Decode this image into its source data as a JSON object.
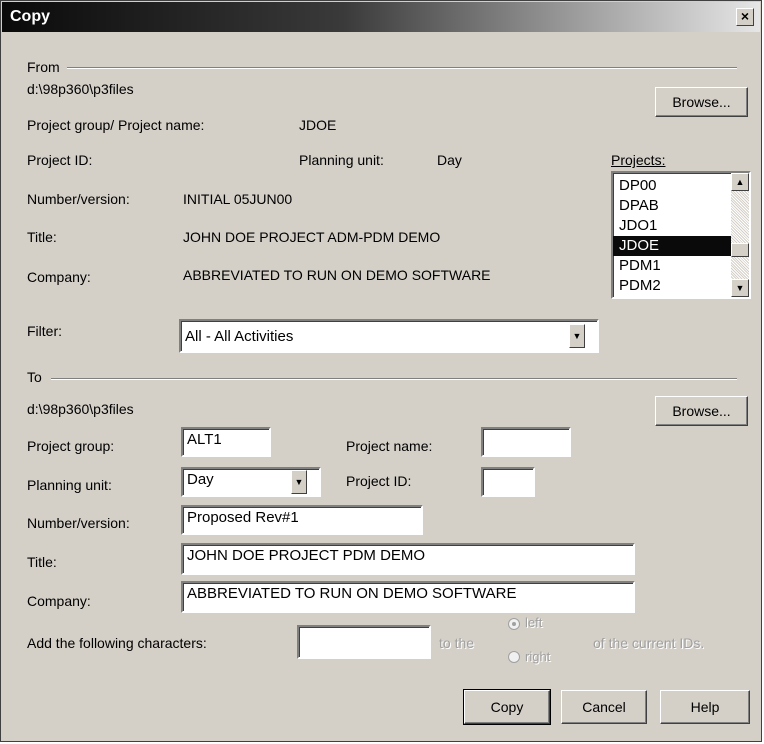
{
  "window": {
    "title": "Copy",
    "close_glyph": "×"
  },
  "from": {
    "header": "From",
    "path": "d:\\98p360\\p3files",
    "browse_label": "Browse...",
    "group_name_label": "Project group/ Project name:",
    "group_name_value": "JDOE",
    "project_id_label": "Project ID:",
    "planning_unit_label": "Planning unit:",
    "planning_unit_value": "Day",
    "number_version_label": "Number/version:",
    "number_version_value": "INITIAL 05JUN00",
    "title_label": "Title:",
    "title_value": "JOHN DOE PROJECT ADM-PDM DEMO",
    "company_label": "Company:",
    "company_value": "ABBREVIATED TO RUN ON DEMO SOFTWARE",
    "projects_label": "Projects:",
    "projects": [
      "DP00",
      "DPAB",
      "JDO1",
      "JDOE",
      "PDM1",
      "PDM2"
    ],
    "projects_selected": "JDOE"
  },
  "filter": {
    "label": "Filter:",
    "value": "All - All Activities"
  },
  "to": {
    "header": "To",
    "path": "d:\\98p360\\p3files",
    "browse_label": "Browse...",
    "project_group_label": "Project group:",
    "project_group_value": "ALT1",
    "project_name_label": "Project name:",
    "project_name_value": "",
    "planning_unit_label": "Planning unit:",
    "planning_unit_value": "Day",
    "project_id_label": "Project ID:",
    "project_id_value": "",
    "number_version_label": "Number/version:",
    "number_version_value": "Proposed Rev#1",
    "title_label": "Title:",
    "title_value": "JOHN DOE PROJECT PDM DEMO",
    "company_label": "Company:",
    "company_value": "ABBREVIATED TO RUN ON DEMO SOFTWARE"
  },
  "add_chars": {
    "label": "Add the following characters:",
    "value": "",
    "to_the": "to the",
    "left_label": "left",
    "right_label": "right",
    "suffix": "of the current IDs."
  },
  "buttons": {
    "copy": "Copy",
    "cancel": "Cancel",
    "help": "Help"
  },
  "icons": {
    "dropdown_arrow": "▼",
    "scroll_up": "▲",
    "scroll_down": "▼"
  }
}
